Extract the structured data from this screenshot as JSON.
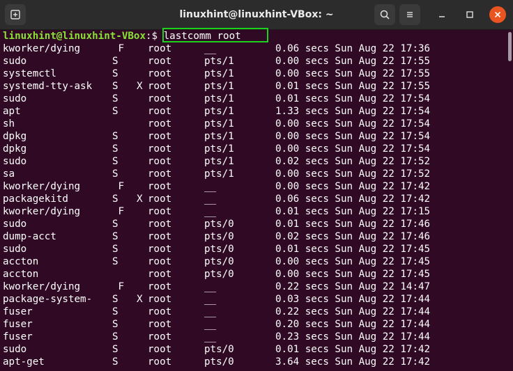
{
  "window": {
    "title": "linuxhint@linuxhint-VBox: ~"
  },
  "icons": {
    "new_tab": "new-tab-icon",
    "search": "search-icon",
    "menu": "hamburger-menu-icon",
    "minimize": "minimize-icon",
    "maximize": "maximize-icon",
    "close": "close-icon"
  },
  "colors": {
    "terminal_bg": "#300a24",
    "prompt_green": "#8ae234",
    "highlight_box": "#1cd21c",
    "close_button": "#e95420"
  },
  "prompt": {
    "user_host": "linuxhint@linuxhint-VBox",
    "colon": ":",
    "command": "$ lastcomm root"
  },
  "rows": [
    {
      "cmd": "kworker/dying",
      "f1": " F",
      "f2": "",
      "user": "root",
      "tty": "__",
      "time": "0.06 secs Sun Aug 22 17:36"
    },
    {
      "cmd": "sudo",
      "f1": "S",
      "f2": "",
      "user": "root",
      "tty": "pts/1",
      "time": "0.00 secs Sun Aug 22 17:55"
    },
    {
      "cmd": "systemctl",
      "f1": "S",
      "f2": "",
      "user": "root",
      "tty": "pts/1",
      "time": "0.00 secs Sun Aug 22 17:55"
    },
    {
      "cmd": "systemd-tty-ask",
      "f1": "S",
      "f2": "X",
      "user": "root",
      "tty": "pts/1",
      "time": "0.01 secs Sun Aug 22 17:55"
    },
    {
      "cmd": "sudo",
      "f1": "S",
      "f2": "",
      "user": "root",
      "tty": "pts/1",
      "time": "0.01 secs Sun Aug 22 17:54"
    },
    {
      "cmd": "apt",
      "f1": "S",
      "f2": "",
      "user": "root",
      "tty": "pts/1",
      "time": "1.33 secs Sun Aug 22 17:54"
    },
    {
      "cmd": "sh",
      "f1": "",
      "f2": "",
      "user": "root",
      "tty": "pts/1",
      "time": "0.00 secs Sun Aug 22 17:54"
    },
    {
      "cmd": "dpkg",
      "f1": "S",
      "f2": "",
      "user": "root",
      "tty": "pts/1",
      "time": "0.00 secs Sun Aug 22 17:54"
    },
    {
      "cmd": "dpkg",
      "f1": "S",
      "f2": "",
      "user": "root",
      "tty": "pts/1",
      "time": "0.00 secs Sun Aug 22 17:54"
    },
    {
      "cmd": "sudo",
      "f1": "S",
      "f2": "",
      "user": "root",
      "tty": "pts/1",
      "time": "0.02 secs Sun Aug 22 17:52"
    },
    {
      "cmd": "sa",
      "f1": "S",
      "f2": "",
      "user": "root",
      "tty": "pts/1",
      "time": "0.00 secs Sun Aug 22 17:52"
    },
    {
      "cmd": "kworker/dying",
      "f1": " F",
      "f2": "",
      "user": "root",
      "tty": "__",
      "time": "0.00 secs Sun Aug 22 17:42"
    },
    {
      "cmd": "packagekitd",
      "f1": "S",
      "f2": "X",
      "user": "root",
      "tty": "__",
      "time": "0.06 secs Sun Aug 22 17:42"
    },
    {
      "cmd": "kworker/dying",
      "f1": " F",
      "f2": "",
      "user": "root",
      "tty": "__",
      "time": "0.01 secs Sun Aug 22 17:15"
    },
    {
      "cmd": "sudo",
      "f1": "S",
      "f2": "",
      "user": "root",
      "tty": "pts/0",
      "time": "0.01 secs Sun Aug 22 17:46"
    },
    {
      "cmd": "dump-acct",
      "f1": "S",
      "f2": "",
      "user": "root",
      "tty": "pts/0",
      "time": "0.02 secs Sun Aug 22 17:46"
    },
    {
      "cmd": "sudo",
      "f1": "S",
      "f2": "",
      "user": "root",
      "tty": "pts/0",
      "time": "0.01 secs Sun Aug 22 17:45"
    },
    {
      "cmd": "accton",
      "f1": "S",
      "f2": "",
      "user": "root",
      "tty": "pts/0",
      "time": "0.00 secs Sun Aug 22 17:45"
    },
    {
      "cmd": "accton",
      "f1": "",
      "f2": "",
      "user": "root",
      "tty": "pts/0",
      "time": "0.00 secs Sun Aug 22 17:45"
    },
    {
      "cmd": "kworker/dying",
      "f1": " F",
      "f2": "",
      "user": "root",
      "tty": "__",
      "time": "0.22 secs Sun Aug 22 14:47"
    },
    {
      "cmd": "package-system-",
      "f1": "S",
      "f2": "X",
      "user": "root",
      "tty": "__",
      "time": "0.03 secs Sun Aug 22 17:44"
    },
    {
      "cmd": "fuser",
      "f1": "S",
      "f2": "",
      "user": "root",
      "tty": "__",
      "time": "0.22 secs Sun Aug 22 17:44"
    },
    {
      "cmd": "fuser",
      "f1": "S",
      "f2": "",
      "user": "root",
      "tty": "__",
      "time": "0.20 secs Sun Aug 22 17:44"
    },
    {
      "cmd": "fuser",
      "f1": "S",
      "f2": "",
      "user": "root",
      "tty": "__",
      "time": "0.23 secs Sun Aug 22 17:44"
    },
    {
      "cmd": "sudo",
      "f1": "S",
      "f2": "",
      "user": "root",
      "tty": "pts/0",
      "time": "0.01 secs Sun Aug 22 17:42"
    },
    {
      "cmd": "apt-get",
      "f1": "S",
      "f2": "",
      "user": "root",
      "tty": "pts/0",
      "time": "3.64 secs Sun Aug 22 17:42"
    }
  ]
}
